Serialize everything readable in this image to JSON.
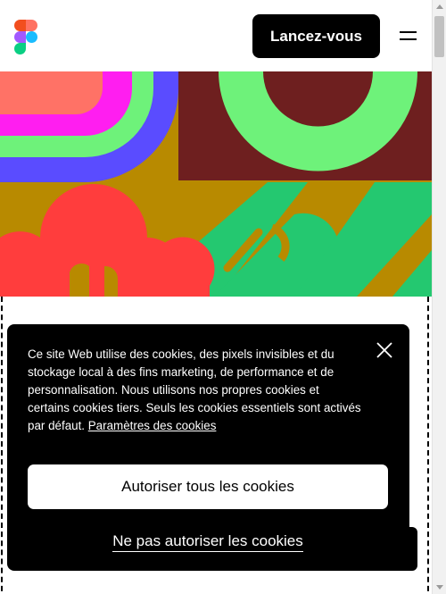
{
  "header": {
    "logo_icon": "figma-logo-icon",
    "cta_label": "Lancez-vous",
    "menu_icon": "hamburger-menu-icon"
  },
  "cookie_banner": {
    "text": "Ce site Web utilise des cookies, des pixels invisibles et du stockage local à des fins marketing, de performance et de personnalisation. Nous utilisons nos propres cookies et certains cookies tiers. Seuls les cookies essentiels sont activés par défaut.",
    "settings_link": "Paramètres des cookies",
    "close_icon": "close-icon",
    "accept_label": "Autoriser tous les cookies",
    "reject_label": "Ne pas autoriser les cookies"
  },
  "colors": {
    "cta_background": "#000000",
    "banner_background": "#000000",
    "hero_mustard": "#b88a00",
    "hero_maroon": "#6e1f1f",
    "hero_green": "#6ef27a",
    "hero_teal_green": "#24c870",
    "hero_red": "#ff3d3d",
    "hero_magenta": "#ff1ef0",
    "hero_blue": "#5a4cff",
    "hero_salmon": "#ff7266"
  }
}
